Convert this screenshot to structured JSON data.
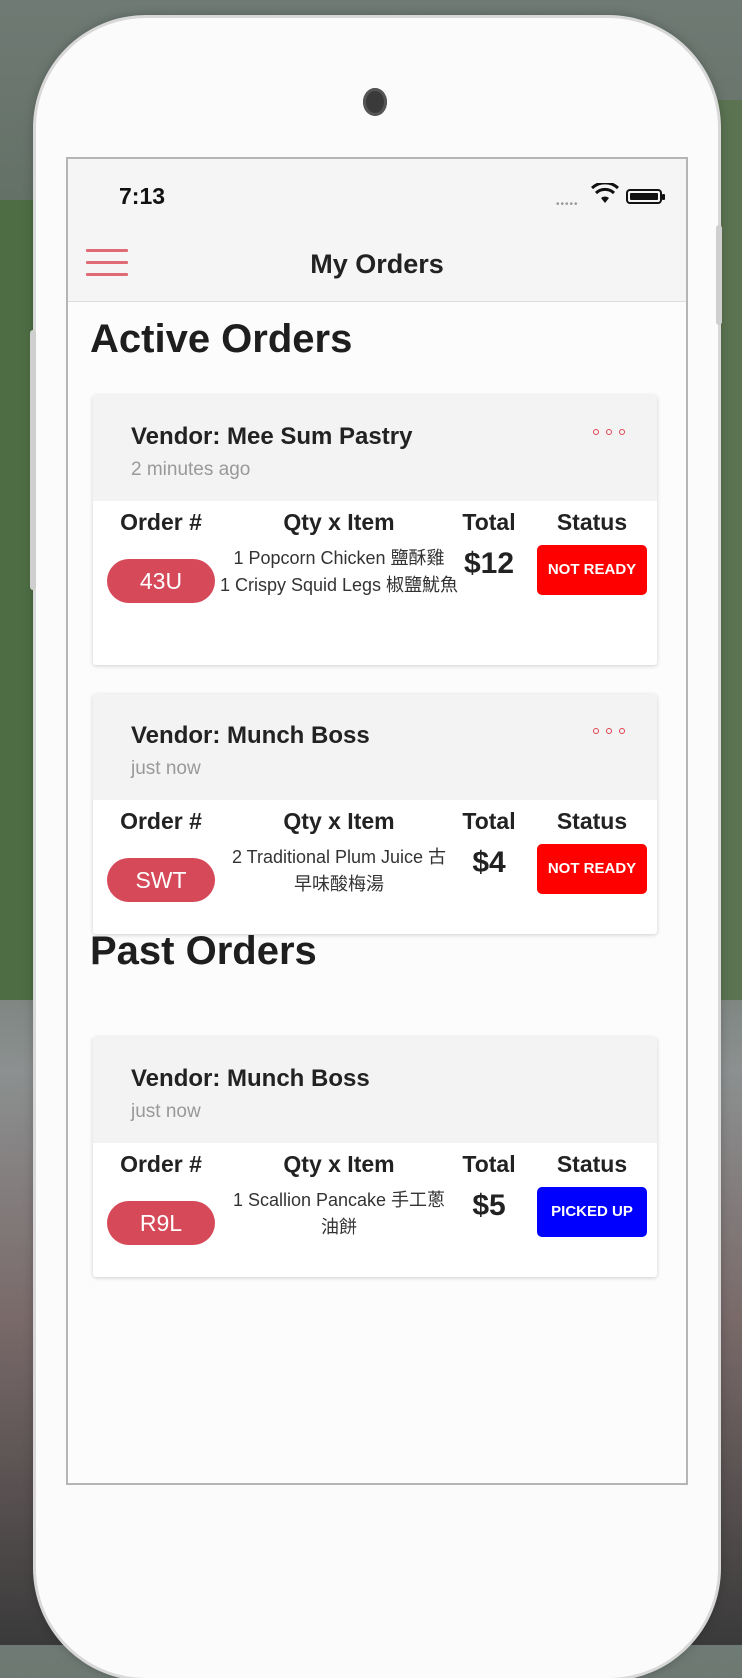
{
  "statusbar": {
    "time": "7:13"
  },
  "nav": {
    "title": "My Orders"
  },
  "sections": {
    "active_title": "Active Orders",
    "past_title": "Past Orders"
  },
  "columns": {
    "order": "Order #",
    "item": "Qty x Item",
    "total": "Total",
    "status": "Status"
  },
  "colors": {
    "accent": "#d64958",
    "not_ready": "#ff0000",
    "picked_up": "#0000ff"
  },
  "active_orders": [
    {
      "vendor": "Vendor: Mee Sum Pastry",
      "ago": "2 minutes ago",
      "order_no": "43U",
      "items": [
        "1 Popcorn Chicken 鹽酥雞",
        "1 Crispy Squid Legs 椒鹽魷魚"
      ],
      "total": "$12",
      "status": "NOT READY"
    },
    {
      "vendor": "Vendor: Munch Boss",
      "ago": "just now",
      "order_no": "SWT",
      "items": [
        "2 Traditional Plum Juice 古早味酸梅湯"
      ],
      "total": "$4",
      "status": "NOT READY"
    }
  ],
  "past_orders": [
    {
      "vendor": "Vendor: Munch Boss",
      "ago": "just now",
      "order_no": "R9L",
      "items": [
        "1 Scallion Pancake 手工蔥油餅"
      ],
      "total": "$5",
      "status": "PICKED UP"
    }
  ]
}
